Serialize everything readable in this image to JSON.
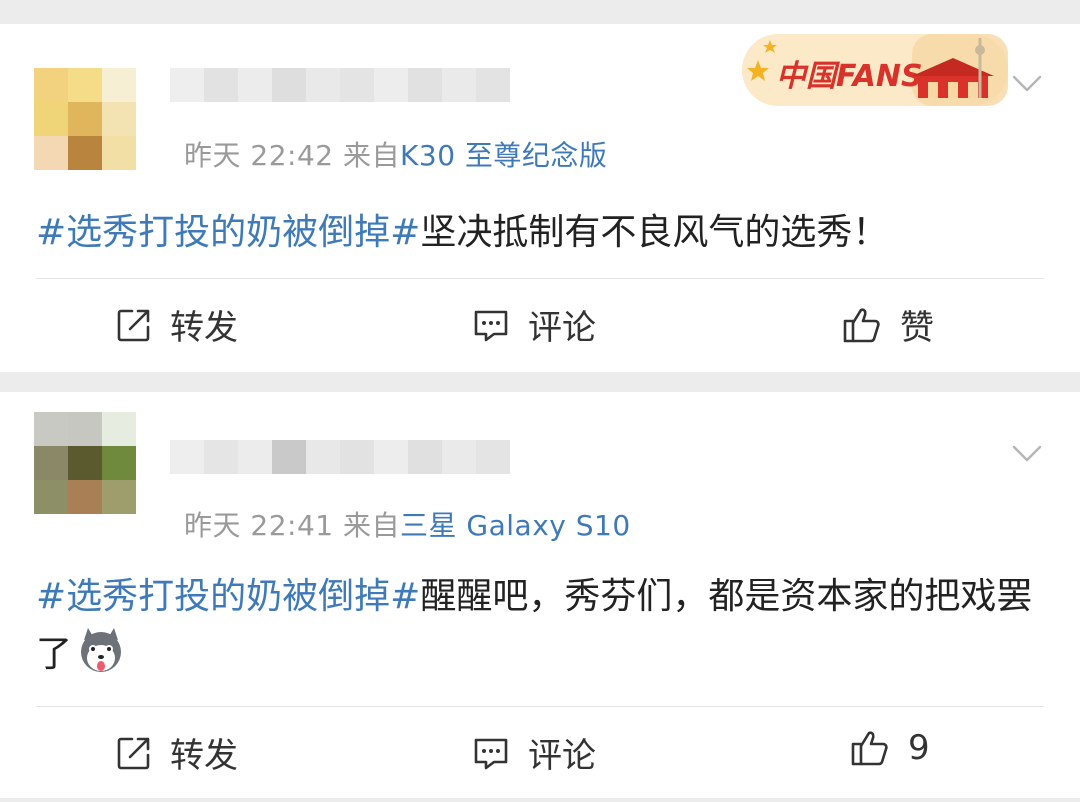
{
  "posts": [
    {
      "time": "昨天 22:42",
      "source_prefix": "来自",
      "source": "K30 至尊纪念版",
      "topic": "#选秀打投的奶被倒掉#",
      "text": "坚决抵制有不良风气的选秀！",
      "badge_text": "中国FANS",
      "actions": {
        "repost": "转发",
        "comment": "评论",
        "like": "赞"
      }
    },
    {
      "time": "昨天 22:41",
      "source_prefix": "来自",
      "source": "三星 Galaxy S10",
      "topic": "#选秀打投的奶被倒掉#",
      "text": "醒醒吧，秀芬们，都是资本家的把戏罢了",
      "actions": {
        "repost": "转发",
        "comment": "评论",
        "like": "9"
      }
    }
  ],
  "icons": {
    "repost": "repost-icon",
    "comment": "comment-icon",
    "like": "thumbs-up-icon",
    "menu": "chevron-down-icon",
    "emoji": "husky-emoji-icon"
  },
  "colors": {
    "topic_link": "#3f7ab8",
    "meta_gray": "#9a9a9a",
    "background": "#ececec",
    "badge_red": "#d8322b",
    "badge_bg": "#fbe9c8"
  }
}
